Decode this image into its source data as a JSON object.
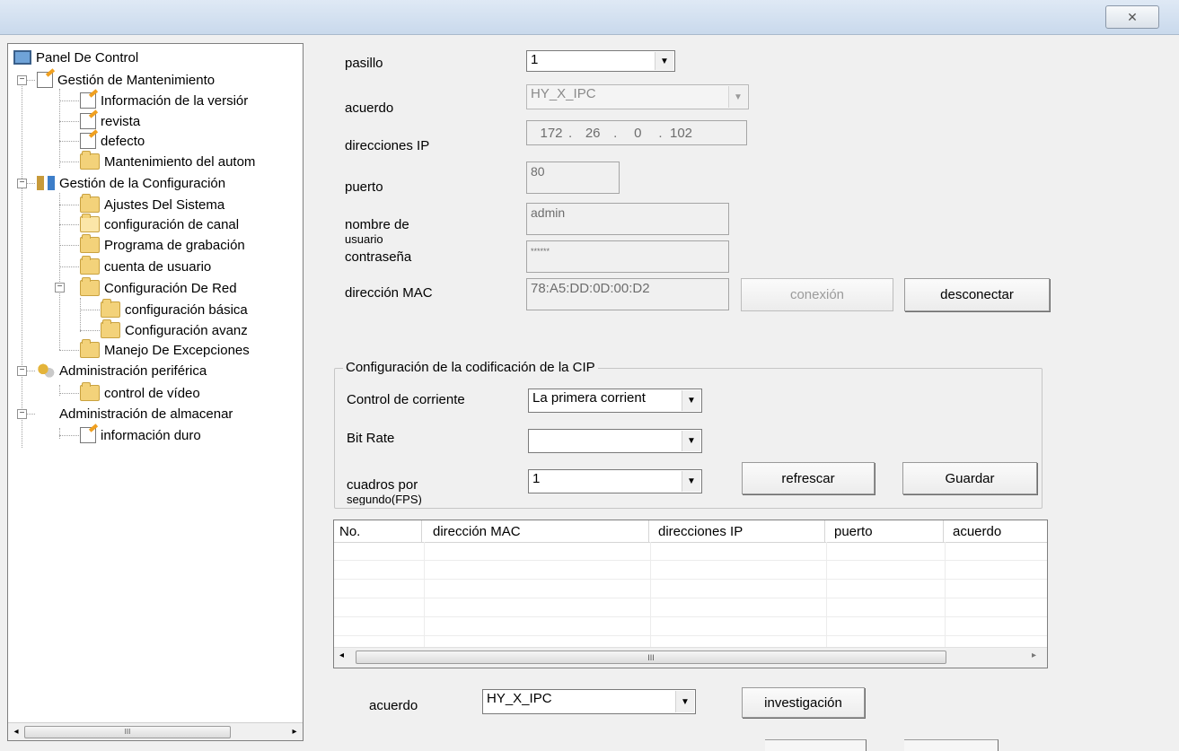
{
  "window": {
    "close_glyph": "✕"
  },
  "tree": {
    "items": [
      {
        "label": "Panel De Control",
        "icon": "monitor-icon"
      },
      {
        "label": "Gestión de Mantenimiento",
        "icon": "edit-document-icon"
      },
      {
        "label": "Información de la versiór",
        "icon": "edit-document-icon"
      },
      {
        "label": "revista",
        "icon": "edit-document-icon"
      },
      {
        "label": "defecto",
        "icon": "edit-document-icon"
      },
      {
        "label": "Mantenimiento del autom",
        "icon": "folder-icon"
      },
      {
        "label": "Gestión de la Configuración",
        "icon": "tools-icon"
      },
      {
        "label": "Ajustes Del Sistema",
        "icon": "folder-icon"
      },
      {
        "label": "configuración de canal",
        "icon": "folder-open-icon"
      },
      {
        "label": "Programa de grabación",
        "icon": "folder-icon"
      },
      {
        "label": "cuenta de usuario",
        "icon": "folder-icon"
      },
      {
        "label": "Configuración De Red",
        "icon": "folder-icon"
      },
      {
        "label": "configuración básica",
        "icon": "folder-icon"
      },
      {
        "label": "Configuración avanz",
        "icon": "folder-icon"
      },
      {
        "label": "Manejo De Excepciones",
        "icon": "folder-icon"
      },
      {
        "label": "Administración periférica",
        "icon": "gears-icon"
      },
      {
        "label": "control de vídeo",
        "icon": "folder-icon"
      },
      {
        "label": "Administración de almacenar",
        "icon": "none"
      },
      {
        "label": "información duro",
        "icon": "edit-document-icon"
      }
    ],
    "scroll_thumb_glyph": "III"
  },
  "form": {
    "pasillo_label": "pasillo",
    "pasillo_value": "1",
    "acuerdo_label": "acuerdo",
    "acuerdo_value": "HY_X_IPC",
    "ip_label": "direcciones IP",
    "ip_octets": [
      "172",
      "26",
      "0",
      "102"
    ],
    "puerto_label": "puerto",
    "puerto_value": "80",
    "usuario_label_1": "nombre de",
    "usuario_label_2": "usuario",
    "usuario_value": "admin",
    "contrasena_label": "contraseña",
    "contrasena_value": "******",
    "mac_label": "dirección MAC",
    "mac_value": "78:A5:DD:0D:00:D2",
    "conexion_button": "conexión",
    "desconectar_button": "desconectar"
  },
  "encoding": {
    "group_title": "Configuración de la codificación de la CIP",
    "stream_label": "Control de corriente",
    "stream_value": "La primera corrient",
    "bitrate_label": "Bit Rate",
    "bitrate_value": "",
    "fps_label_1": "cuadros por",
    "fps_label_2": "segundo(FPS)",
    "fps_value": "1",
    "refresh_button": "refrescar",
    "save_button": "Guardar"
  },
  "device_list": {
    "columns": [
      "No.",
      "dirección MAC",
      "direcciones IP",
      "puerto",
      "acuerdo"
    ],
    "rows": [],
    "scroll_thumb_glyph": "III"
  },
  "search": {
    "acuerdo_label": "acuerdo",
    "acuerdo_value": "HY_X_IPC",
    "search_button": "investigación"
  }
}
